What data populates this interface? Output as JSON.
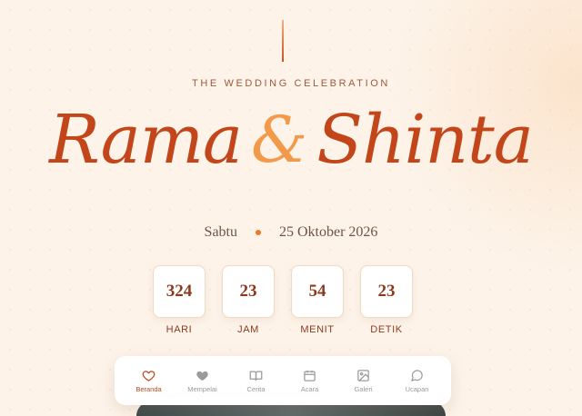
{
  "header": {
    "subtitle": "THE WEDDING CELEBRATION",
    "groom": "Rama",
    "ampersand": "&",
    "bride": "Shinta"
  },
  "date": {
    "day": "Sabtu",
    "full": "25 Oktober 2026"
  },
  "countdown": [
    {
      "value": "324",
      "label": "HARI"
    },
    {
      "value": "23",
      "label": "JAM"
    },
    {
      "value": "54",
      "label": "MENIT"
    },
    {
      "value": "23",
      "label": "DETIK"
    }
  ],
  "nav": {
    "active": "Beranda",
    "items": [
      {
        "label": "Beranda",
        "icon": "heart-outline-icon"
      },
      {
        "label": "Mempelai",
        "icon": "heart-filled-icon"
      },
      {
        "label": "Cerita",
        "icon": "book-icon"
      },
      {
        "label": "Acara",
        "icon": "calendar-icon"
      },
      {
        "label": "Galeri",
        "icon": "image-icon"
      },
      {
        "label": "Ucapan",
        "icon": "chat-bubble-icon"
      }
    ]
  },
  "colors": {
    "accent": "#c2461a",
    "ampersand": "#f39a4a",
    "background": "#fdf3e9",
    "dot": "#f07a22"
  }
}
